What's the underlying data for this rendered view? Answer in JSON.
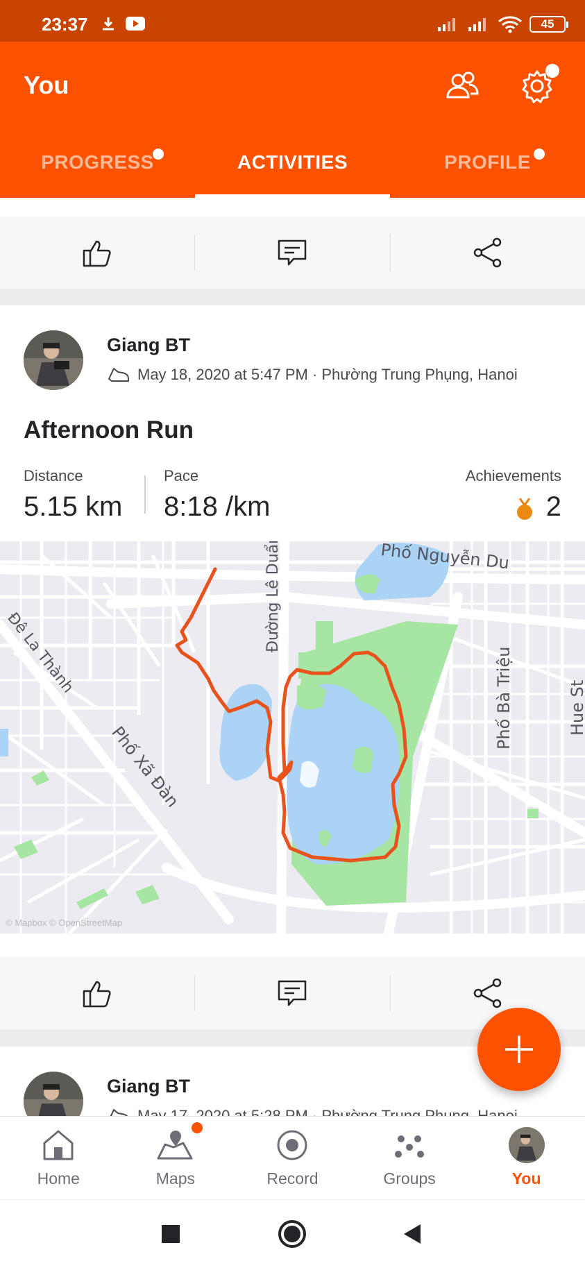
{
  "status_bar": {
    "time": "23:37",
    "battery": "45"
  },
  "header": {
    "title": "You"
  },
  "tabs": [
    {
      "label": "PROGRESS",
      "badge": true
    },
    {
      "label": "ACTIVITIES",
      "active": true
    },
    {
      "label": "PROFILE",
      "badge": true
    }
  ],
  "activity": {
    "athlete": "Giang BT",
    "meta": "May 18, 2020 at 5:47 PM · Phường Trung Phụng, Hanoi",
    "title": "Afternoon Run",
    "stats": {
      "distance_label": "Distance",
      "distance_value": "5.15 km",
      "pace_label": "Pace",
      "pace_value": "8:18 /km",
      "achievements_label": "Achievements",
      "achievements_value": "2"
    },
    "map": {
      "labels": [
        "Phố Nguyễn Du",
        "Đê La Thành",
        "Phố Xã Đàn",
        "Đường Lê Duẩn",
        "Phố Bà Triệu",
        "Hue St"
      ],
      "attribution": "© Mapbox © OpenStreetMap"
    }
  },
  "next_activity": {
    "athlete": "Giang BT",
    "meta": "May 17, 2020 at 5:28 PM · Phường Trung Phụng, Hanoi"
  },
  "bottom_nav": [
    {
      "label": "Home",
      "icon": "home-icon"
    },
    {
      "label": "Maps",
      "icon": "maps-icon",
      "badge": true
    },
    {
      "label": "Record",
      "icon": "record-icon"
    },
    {
      "label": "Groups",
      "icon": "groups-icon"
    },
    {
      "label": "You",
      "icon": "avatar",
      "active": true
    }
  ],
  "colors": {
    "brand": "#fc5200",
    "status_bar": "#c94400",
    "route": "#e8521c",
    "water": "#aad3f5",
    "park": "#9fe09b"
  }
}
